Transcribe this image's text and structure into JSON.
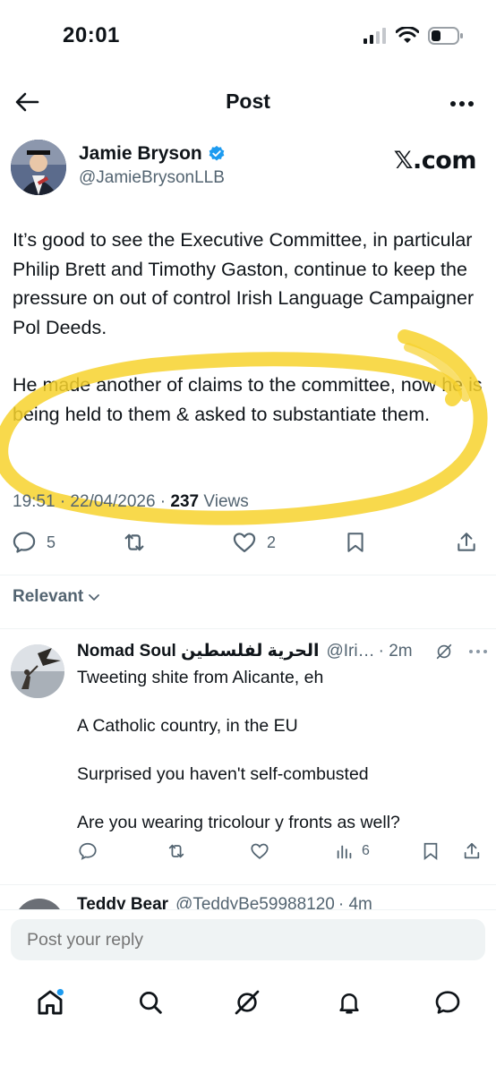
{
  "status_bar": {
    "time": "20:01",
    "icons": [
      "signal-icon",
      "wifi-icon",
      "battery-icon"
    ]
  },
  "header": {
    "title": "Post",
    "back_icon": "back-arrow-icon",
    "more_icon": "more-icon"
  },
  "author": {
    "name": "Jamie Bryson",
    "handle": "@JamieBrysonLLB",
    "verified": true,
    "watermark": "𝕏.com"
  },
  "post": {
    "paragraphs": [
      "It’s good to see the Executive Committee, in particular Philip Brett and Timothy Gaston, continue to keep the pressure on out of control Irish Language Campaigner Pol Deeds.",
      "He made another of claims to the committee, now he is being held to them & asked to substantiate them."
    ],
    "timestamp": "19:51 · 22/04/2026 ·",
    "views_count": "237",
    "views_label": "Views",
    "highlight_color": "#f7d22d"
  },
  "actions": {
    "replies": "5",
    "reposts": "",
    "likes": "2"
  },
  "sort": {
    "label": "Relevant"
  },
  "replies": [
    {
      "name": "Nomad Soul الحرية لفلسطين",
      "handle": "@Iri…",
      "time": "· 2m",
      "body": [
        "Tweeting shite from Alicante, eh",
        "A Catholic country, in the EU",
        "Surprised you haven't self-combusted",
        "Are you wearing  tricolour y fronts as well?"
      ],
      "views": "6"
    },
    {
      "name": "Teddy Bear",
      "handle": "@TeddyBe59988120",
      "time": "· 4m"
    }
  ],
  "reply_box": {
    "placeholder": "Post your reply"
  },
  "nav": [
    "home-icon",
    "search-icon",
    "grok-icon",
    "notifications-icon",
    "messages-icon"
  ],
  "colors": {
    "accent": "#1d9bf0",
    "text": "#0f1419",
    "secondary": "#536471"
  }
}
